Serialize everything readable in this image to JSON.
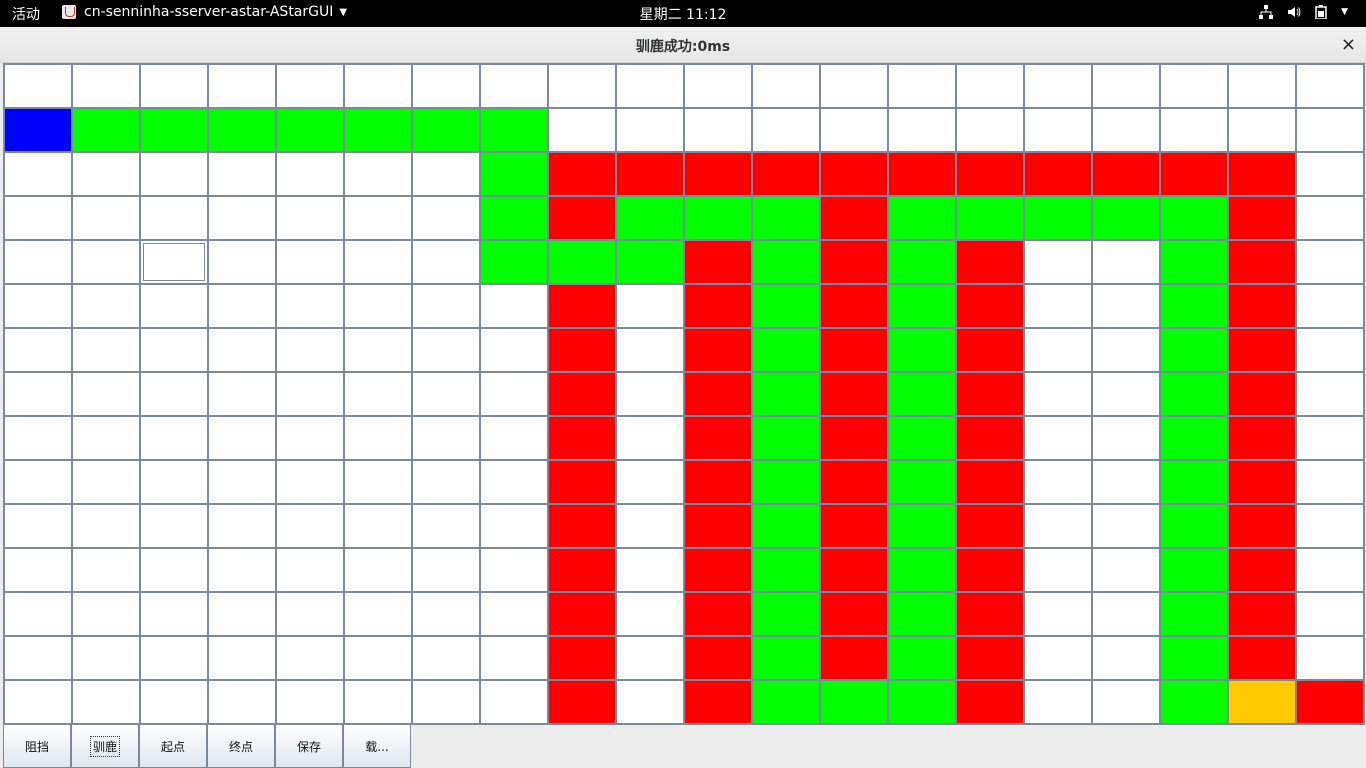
{
  "topbar": {
    "activities": "活动",
    "app_name": "cn-senninha-sserver-astar-AStarGUI",
    "clock": "星期二 11:12",
    "tray_icons": [
      "network-icon",
      "volume-icon",
      "battery-icon"
    ]
  },
  "window": {
    "title": "驯鹿成功:0ms",
    "close_glyph": "×"
  },
  "grid": {
    "columns": 20,
    "rows": 15,
    "legend": {
      "w": "empty",
      "b": "start",
      "y": "end",
      "r": "block",
      "g": "path"
    },
    "colors": {
      "w": "#ffffff",
      "b": "#0000ff",
      "g": "#00ff00",
      "r": "#ff0000",
      "y": "#ffc800"
    },
    "cells": [
      "wwwwwwwwwwwwwwwwwwww",
      "bgggggggwwwwwwwwwwww",
      "wwwwwwwgrrrrrrrrrrrw",
      "wwwwwwwgrgggrgggggrw",
      "wwwwwwwgggrgrgrwwgrw",
      "wwwwwwwwrwrgrgrwwgrw",
      "wwwwwwwwrwrgrgrwwgrw",
      "wwwwwwwwrwrgrgrwwgrw",
      "wwwwwwwwrwrgrgrwwgrw",
      "wwwwwwwwrwrgrgrwwgrw",
      "wwwwwwwwrwrgrgrwwgrw",
      "wwwwwwwwrwrgrgrwwgrw",
      "wwwwwwwwrwrgrgrwwgrw",
      "wwwwwwwwrwrgrgrwwgrw",
      "wwwwwwwwrwrgggrwwgyr"
    ]
  },
  "toolbar": {
    "buttons": [
      {
        "label": "阻挡",
        "name": "block-button"
      },
      {
        "label": "驯鹿",
        "name": "find-path-button",
        "active": true
      },
      {
        "label": "起点",
        "name": "start-point-button"
      },
      {
        "label": "终点",
        "name": "end-point-button"
      },
      {
        "label": "保存",
        "name": "save-button"
      },
      {
        "label": "载...",
        "name": "load-button"
      }
    ]
  }
}
